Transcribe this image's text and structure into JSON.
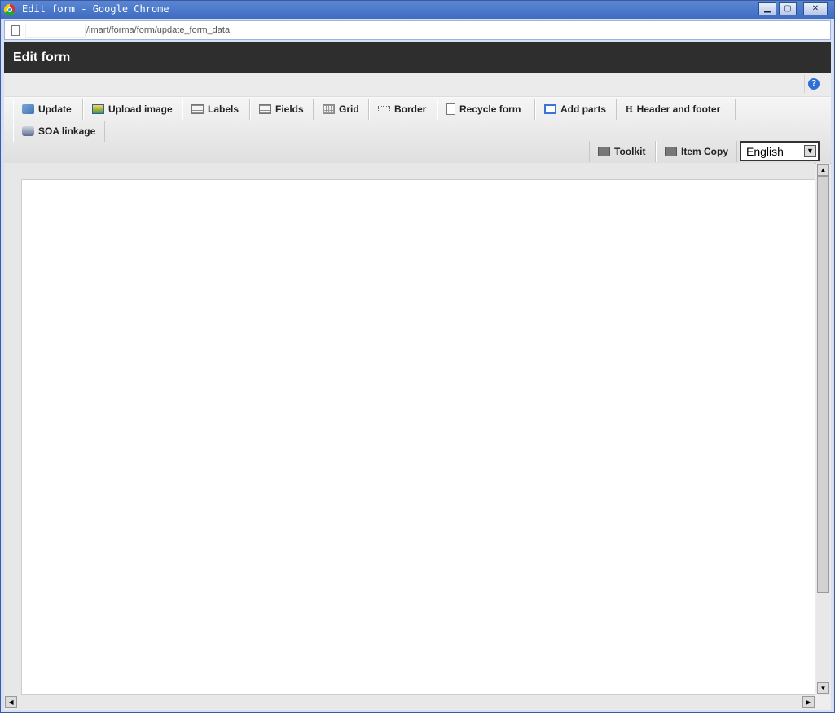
{
  "window": {
    "title": "Edit form - Google Chrome",
    "minimize": "▁",
    "maximize": "▢",
    "close": "✕"
  },
  "address": {
    "path": "/imart/forma/form/update_form_data"
  },
  "page": {
    "header_title": "Edit form",
    "help_label": "?"
  },
  "toolbar": {
    "update": "Update",
    "upload_image": "Upload image",
    "labels": "Labels",
    "fields": "Fields",
    "grid": "Grid",
    "border": "Border",
    "recycle_form": "Recycle form",
    "add_parts": "Add parts",
    "header_footer": "Header and footer",
    "header_icon": "H",
    "soa_linkage": "SOA linkage",
    "toolkit": "Toolkit",
    "item_copy": "Item Copy",
    "language": "English"
  },
  "icons": {
    "update": "update-icon",
    "upload_image": "image-upload-icon",
    "labels": "labels-icon",
    "fields": "fields-icon",
    "grid": "grid-icon",
    "border": "border-icon",
    "recycle_form": "document-copy-icon",
    "add_parts": "add-parts-icon",
    "header_footer": "header-icon",
    "soa_linkage": "share-icon",
    "toolkit": "toolbox-icon",
    "item_copy": "toolbox-icon"
  },
  "scrollbar_arrows": {
    "up": "▲",
    "down": "▼",
    "left": "◀",
    "right": "▶"
  }
}
